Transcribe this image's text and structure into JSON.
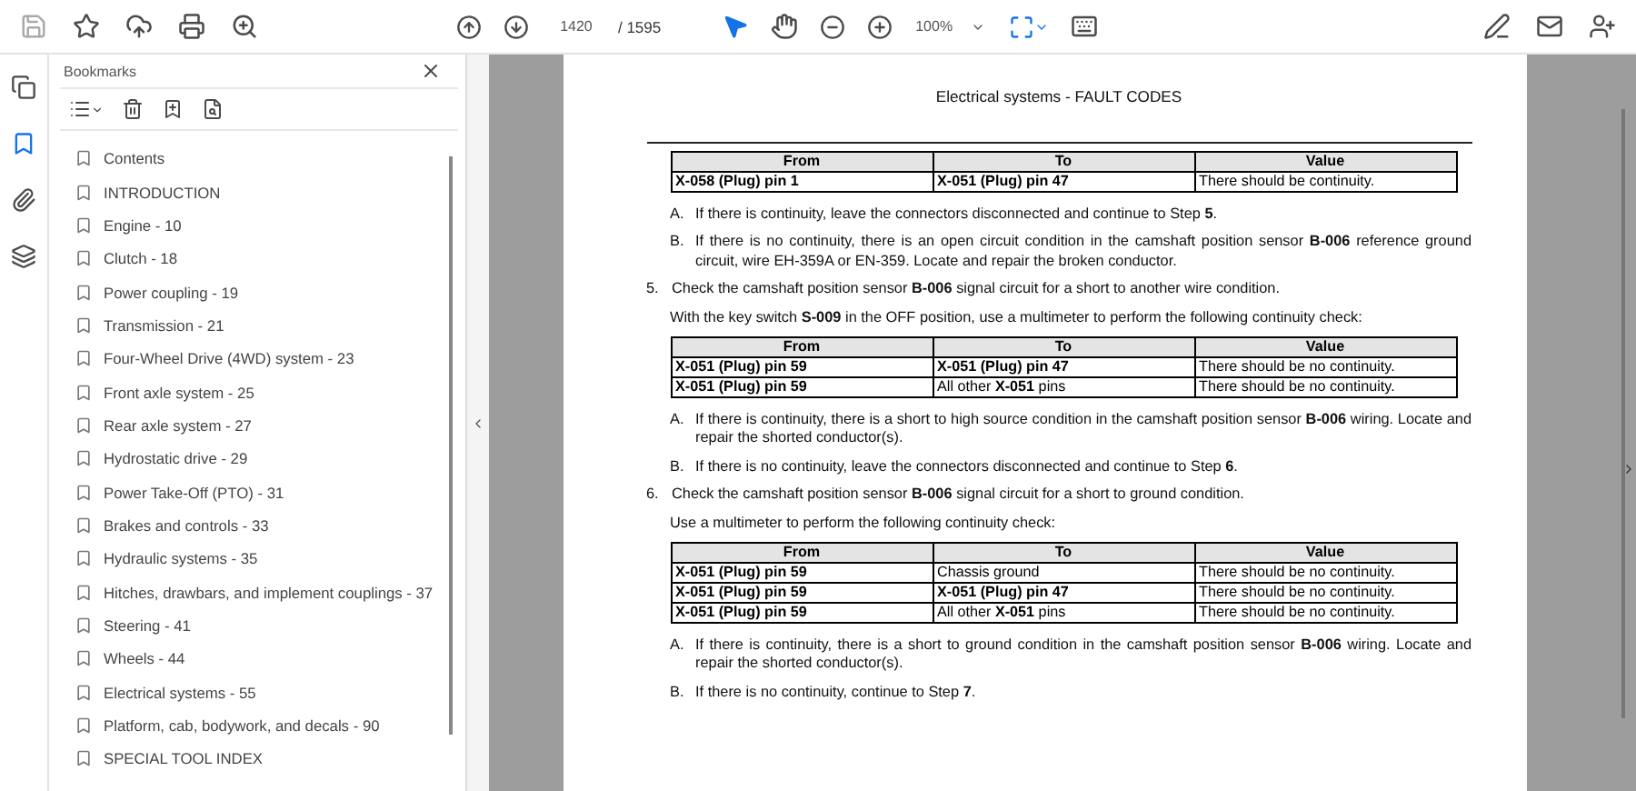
{
  "toolbar": {
    "page_input": "1420",
    "page_total": "/ 1595",
    "zoom": "100%"
  },
  "rail": [
    {
      "kind": "pages",
      "selected": false
    },
    {
      "kind": "bookmarks",
      "selected": true
    },
    {
      "kind": "attachments",
      "selected": false
    },
    {
      "kind": "layers",
      "selected": false
    }
  ],
  "bookmarks": {
    "title": "Bookmarks",
    "items": [
      "Contents",
      "INTRODUCTION",
      "Engine - 10",
      "Clutch - 18",
      "Power coupling - 19",
      "Transmission - 21",
      "Four-Wheel Drive (4WD) system - 23",
      "Front axle system - 25",
      "Rear axle system - 27",
      "Hydrostatic drive - 29",
      "Power Take-Off (PTO) - 31",
      "Brakes and controls - 33",
      "Hydraulic systems - 35",
      "Hitches, drawbars, and implement couplings - 37",
      "Steering - 41",
      "Wheels - 44",
      "Electrical systems - 55",
      "Platform, cab, bodywork, and decals - 90",
      "SPECIAL TOOL INDEX"
    ]
  },
  "document": {
    "header": "Electrical systems - FAULT CODES",
    "blocks": [
      {
        "kind": "table",
        "columns": [
          "From",
          "To",
          "Value"
        ],
        "rows": [
          [
            {
              "text": "X-058 (Plug) pin 1",
              "bold": true
            },
            {
              "text": "X-051 (Plug) pin 47",
              "bold": true
            },
            {
              "text": "There should be continuity.",
              "bold": false
            }
          ]
        ]
      },
      {
        "kind": "sub",
        "marker": "A.",
        "text": "If there is continuity, leave the connectors disconnected and continue to Step **5**."
      },
      {
        "kind": "sub",
        "marker": "B.",
        "text": "If there is no continuity, there is an open circuit condition in the camshaft position sensor **B-006** reference ground circuit, wire EH-359A or EN-359. Locate and repair the broken conductor."
      },
      {
        "kind": "step",
        "marker": "5.",
        "text": "Check the camshaft position sensor **B-006** signal circuit for a short to another wire condition."
      },
      {
        "kind": "note",
        "text": "With the key switch **S-009** in the OFF position, use a multimeter to perform the following continuity check:"
      },
      {
        "kind": "table",
        "columns": [
          "From",
          "To",
          "Value"
        ],
        "rows": [
          [
            {
              "text": "X-051 (Plug) pin 59",
              "bold": true
            },
            {
              "text": "X-051 (Plug) pin 47",
              "bold": true
            },
            {
              "text": "There should be no continuity.",
              "bold": false
            }
          ],
          [
            {
              "text": "X-051 (Plug) pin 59",
              "bold": true
            },
            {
              "text": "All other **X-051** pins",
              "bold": false
            },
            {
              "text": "There should be no continuity.",
              "bold": false
            }
          ]
        ]
      },
      {
        "kind": "sub",
        "marker": "A.",
        "text": "If there is continuity, there is a short to high source condition in the camshaft position sensor **B-006** wiring. Locate and repair the shorted conductor(s)."
      },
      {
        "kind": "sub",
        "marker": "B.",
        "text": "If there is no continuity, leave the connectors disconnected and continue to Step **6**."
      },
      {
        "kind": "step",
        "marker": "6.",
        "text": "Check the camshaft position sensor **B-006** signal circuit for a short to ground condition."
      },
      {
        "kind": "note",
        "text": "Use a multimeter to perform the following continuity check:"
      },
      {
        "kind": "table",
        "columns": [
          "From",
          "To",
          "Value"
        ],
        "rows": [
          [
            {
              "text": "X-051 (Plug) pin 59",
              "bold": true
            },
            {
              "text": "Chassis ground",
              "bold": false
            },
            {
              "text": "There should be no continuity.",
              "bold": false
            }
          ],
          [
            {
              "text": "X-051 (Plug) pin 59",
              "bold": true
            },
            {
              "text": "X-051 (Plug) pin 47",
              "bold": true
            },
            {
              "text": "There should be no continuity.",
              "bold": false
            }
          ],
          [
            {
              "text": "X-051 (Plug) pin 59",
              "bold": true
            },
            {
              "text": "All other **X-051** pins",
              "bold": false
            },
            {
              "text": "There should be no continuity.",
              "bold": false
            }
          ]
        ]
      },
      {
        "kind": "sub",
        "marker": "A.",
        "text": "If there is continuity, there is a short to ground condition in the camshaft position sensor **B-006** wiring. Locate and repair the shorted conductor(s)."
      },
      {
        "kind": "sub",
        "marker": "B.",
        "text": "If there is no continuity, continue to Step **7**."
      }
    ]
  }
}
